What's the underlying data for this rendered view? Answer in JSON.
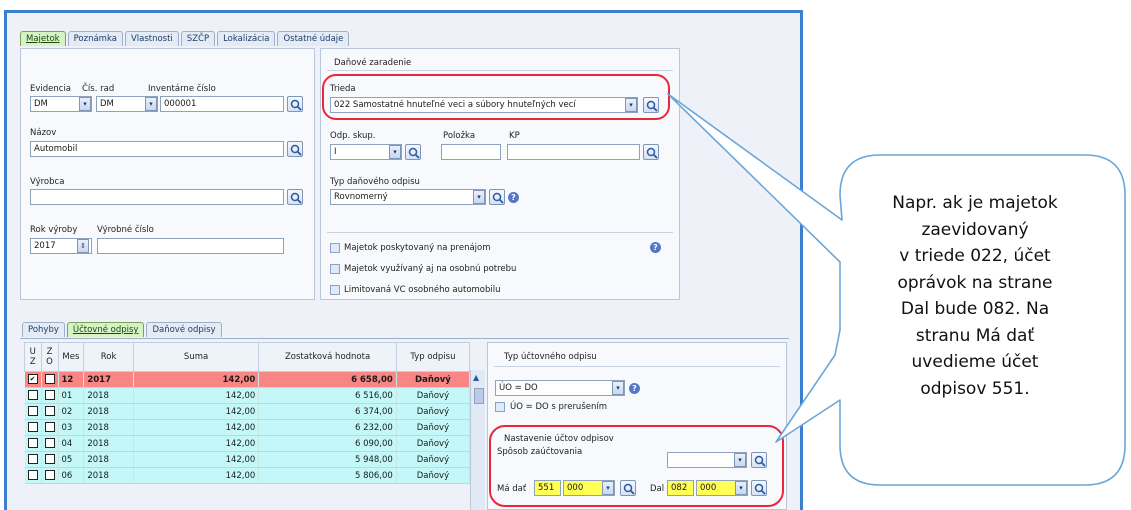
{
  "top_tabs": [
    "Majetok",
    "Poznámka",
    "Vlastnosti",
    "SZČP",
    "Lokalizácia",
    "Ostatné údaje"
  ],
  "left": {
    "evidencia_label": "Evidencia",
    "cis_rad_label": "Čís. rad",
    "inventarne_label": "Inventárne číslo",
    "evidencia_value": "DM",
    "cis_rad_value": "DM",
    "inventarne_value": "000001",
    "nazov_label": "Názov",
    "nazov_value": "Automobil",
    "vyrobca_label": "Výrobca",
    "vyrobca_value": "",
    "rok_vyroby_label": "Rok výroby",
    "vyrobne_cislo_label": "Výrobné číslo",
    "rok_vyroby_value": "2017",
    "vyrobne_cislo_value": ""
  },
  "tax": {
    "group_title": "Daňové zaradenie",
    "trieda_label": "Trieda",
    "trieda_value": "022 Samostatné hnuteľné veci a súbory hnuteľných vecí",
    "odp_skup_label": "Odp. skup.",
    "odp_skup_value": "I",
    "polozka_label": "Položka",
    "kp_label": "KP",
    "typ_label": "Typ daňového odpisu",
    "typ_value": "Rovnomerný",
    "check1": "Majetok poskytovaný na prenájom",
    "check2": "Majetok využívaný aj na osobnú potrebu",
    "check3": "Limitovaná VC osobného automobilu"
  },
  "bottom_tabs": [
    "Pohyby",
    "Účtovné odpisy",
    "Daňové odpisy"
  ],
  "table": {
    "headers": {
      "uz": "U Z",
      "zo": "Z O",
      "mes": "Mes",
      "rok": "Rok",
      "suma": "Suma",
      "zost": "Zostatková hodnota",
      "typ": "Typ odpisu"
    },
    "rows": [
      {
        "mes": "12",
        "rok": "2017",
        "suma": "142,00",
        "zost": "6 658,00",
        "typ": "Daňový"
      },
      {
        "mes": "01",
        "rok": "2018",
        "suma": "142,00",
        "zost": "6 516,00",
        "typ": "Daňový"
      },
      {
        "mes": "02",
        "rok": "2018",
        "suma": "142,00",
        "zost": "6 374,00",
        "typ": "Daňový"
      },
      {
        "mes": "03",
        "rok": "2018",
        "suma": "142,00",
        "zost": "6 232,00",
        "typ": "Daňový"
      },
      {
        "mes": "04",
        "rok": "2018",
        "suma": "142,00",
        "zost": "6 090,00",
        "typ": "Daňový"
      },
      {
        "mes": "05",
        "rok": "2018",
        "suma": "142,00",
        "zost": "5 948,00",
        "typ": "Daňový"
      },
      {
        "mes": "06",
        "rok": "2018",
        "suma": "142,00",
        "zost": "5 806,00",
        "typ": "Daňový"
      }
    ]
  },
  "right_bottom": {
    "typ_title": "Typ účtovného odpisu",
    "typ_value": "ÚO = DO",
    "check_label": "ÚO = DO s prerušením",
    "nastavenie_title": "Nastavenie účtov odpisov",
    "sposob_label": "Spôsob zaúčtovania",
    "ma_dat_label": "Má dať",
    "ma_dat_ucet": "551",
    "ma_dat_analytika": "000",
    "dal_label": "Dal",
    "dal_ucet": "082",
    "dal_analytika": "000"
  },
  "callout": {
    "lines": [
      "Napr. ak je majetok",
      "zaevidovaný",
      "v triede 022, účet",
      "oprávok na strane",
      "Dal bude 082. Na",
      "stranu Má dať",
      "uvedieme účet",
      "odpisov 551."
    ]
  }
}
